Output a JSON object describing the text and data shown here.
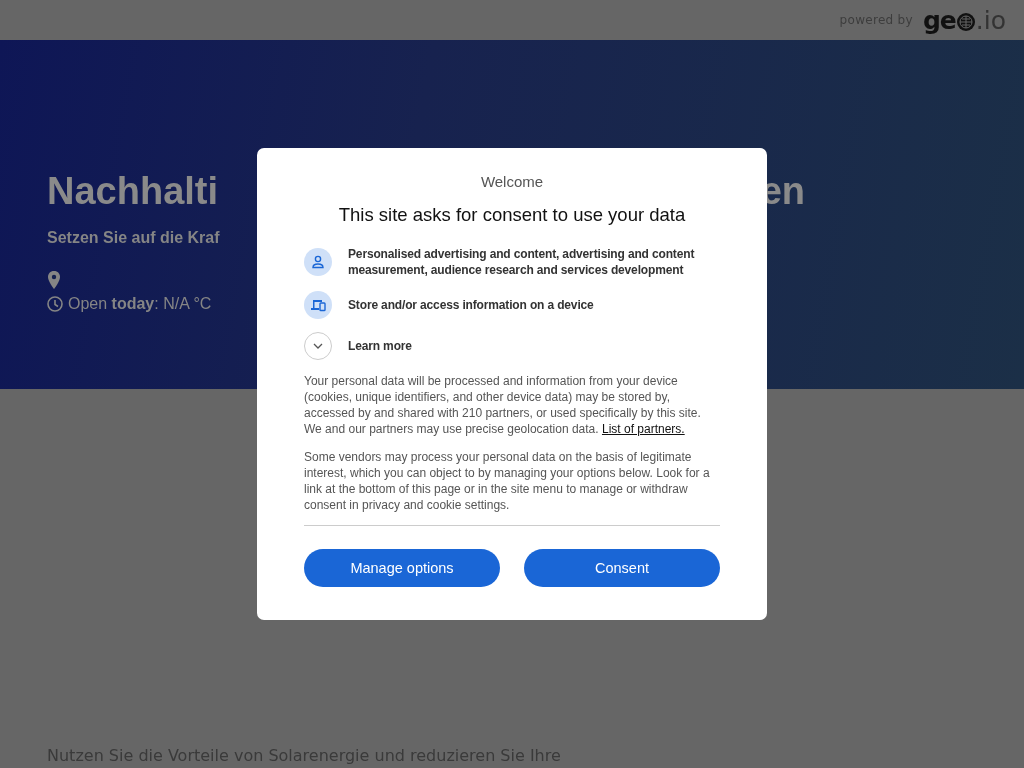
{
  "header": {
    "powered_by": "powered by",
    "logo_start": "ge",
    "logo_end": ".io"
  },
  "hero": {
    "title_start": "Nachhalti",
    "title_end": "en",
    "subtitle": "Setzen Sie auf die Kraf",
    "hours": "Open **today**: N/A °C"
  },
  "intro": "Nutzen Sie die Vorteile von Solarenergie und reduzieren Sie Ihre",
  "consent": {
    "heading": "Welcome",
    "title": "This site asks for consent to use your data",
    "purposes": [
      {
        "kind": "person",
        "text": "Personalised advertising and content, advertising and content measurement, audience research and services development"
      },
      {
        "kind": "device",
        "text": "Store and/or access information on a device"
      }
    ],
    "learn_more": {
      "label": "Learn more",
      "expanded": false
    },
    "paragraphs": [
      {
        "text": "Your personal data will be processed and information from your device (cookies, unique identifiers, and other device data) may be stored by, accessed by and shared with 210 partners, or used specifically by this site. We and our partners may use precise geolocation data.",
        "link": "List of partners."
      },
      {
        "text": "Some vendors may process your personal data on the basis of legitimate interest, which you can object to by managing your options below. Look for a link at the bottom of this page or in the site menu to manage or withdraw consent in privacy and cookie settings."
      }
    ],
    "buttons": [
      "Manage options",
      "Consent"
    ]
  }
}
